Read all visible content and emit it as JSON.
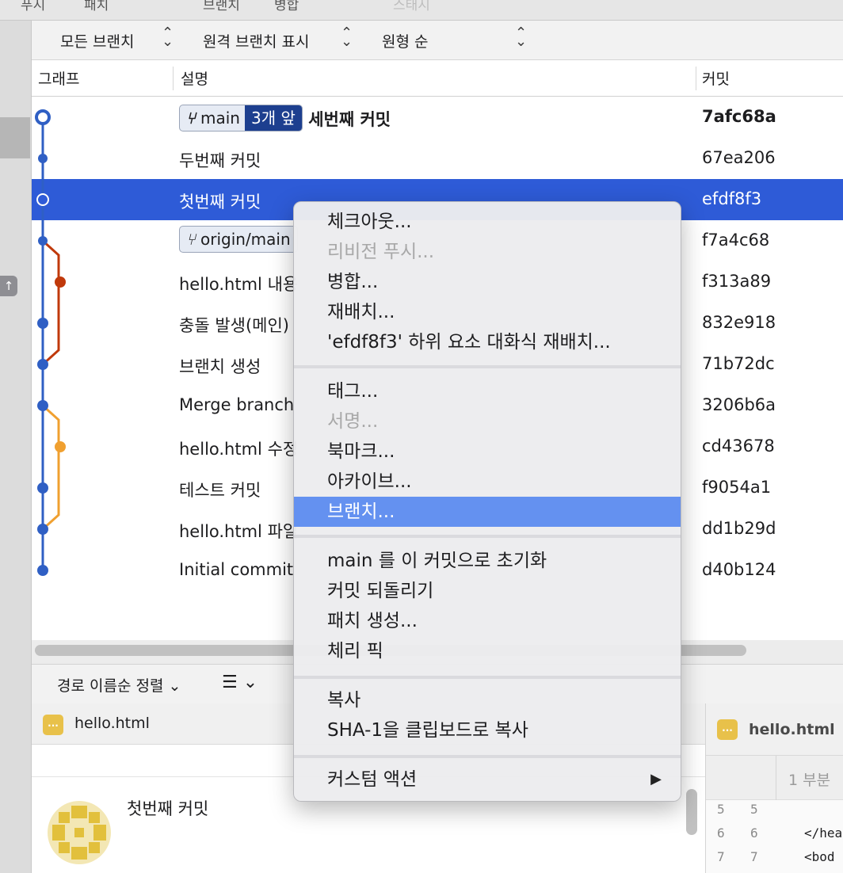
{
  "toolbar": {
    "push": "푸시",
    "pull": "패치",
    "branch": "브랜치",
    "merge": "병합",
    "stash": "스태시"
  },
  "filters": {
    "branches": "모든 브랜치",
    "remote": "원격 브랜치 표시",
    "order": "원형 순"
  },
  "columns": {
    "graph": "그래프",
    "description": "설명",
    "commit": "커밋"
  },
  "commits": [
    {
      "branch": "main",
      "ahead": "3개 앞",
      "desc": "세번째 커밋",
      "hash": "7afc68a"
    },
    {
      "desc": "두번째 커밋",
      "hash": "67ea206"
    },
    {
      "desc": "첫번째 커밋",
      "hash": "efdf8f3"
    },
    {
      "branch": "origin/main",
      "desc": "",
      "hash": "f7a4c68"
    },
    {
      "desc": "hello.html 내용",
      "hash": "f313a89"
    },
    {
      "desc": "충돌 발생(메인)",
      "hash": "832e918"
    },
    {
      "desc": "브랜치 생성",
      "hash": "71b72dc"
    },
    {
      "desc": "Merge branch",
      "hash": "3206b6a"
    },
    {
      "desc": "hello.html 수정",
      "hash": "cd43678"
    },
    {
      "desc": "테스트 커밋",
      "hash": "f9054a1"
    },
    {
      "desc": "hello.html 파일",
      "hash": "dd1b29d"
    },
    {
      "desc": "Initial commit",
      "hash": "d40b124"
    }
  ],
  "context_menu": {
    "items": [
      {
        "label": "체크아웃...",
        "enabled": true
      },
      {
        "label": "리비전 푸시...",
        "enabled": false
      },
      {
        "label": "병합...",
        "enabled": true
      },
      {
        "label": "재배치...",
        "enabled": true
      },
      {
        "label": "'efdf8f3' 하위 요소 대화식 재배치...",
        "enabled": true
      },
      {
        "label": "태그...",
        "enabled": true
      },
      {
        "label": "서명...",
        "enabled": false
      },
      {
        "label": "북마크...",
        "enabled": true
      },
      {
        "label": "아카이브...",
        "enabled": true
      },
      {
        "label": "브랜치...",
        "enabled": true,
        "highlighted": true
      },
      {
        "label": "main 를 이 커밋으로 초기화",
        "enabled": true
      },
      {
        "label": "커밋 되돌리기",
        "enabled": true
      },
      {
        "label": "패치 생성...",
        "enabled": true
      },
      {
        "label": "체리 픽",
        "enabled": true
      },
      {
        "label": "복사",
        "enabled": true
      },
      {
        "label": "SHA-1을 클립보드로 복사",
        "enabled": true
      },
      {
        "label": "커스텀 액션",
        "enabled": true,
        "submenu": true
      }
    ]
  },
  "bottom": {
    "sort_label": "경로 이름순 정렬",
    "file_name": "hello.html",
    "file_icon": "...",
    "commit_title": "첫번째 커밋"
  },
  "diff": {
    "file_name": "hello.html",
    "hunk_label": "1 부분",
    "lines": [
      {
        "old": "5",
        "new": "5",
        "text": ""
      },
      {
        "old": "6",
        "new": "6",
        "text": "</hea"
      },
      {
        "old": "7",
        "new": "7",
        "text": "<bod"
      }
    ]
  },
  "colors": {
    "selection": "#2e5bd7",
    "graph_main": "#2f5fc4",
    "graph_branch_red": "#c0390b",
    "graph_branch_orange": "#f0a030",
    "menu_highlight": "#6491f0"
  }
}
